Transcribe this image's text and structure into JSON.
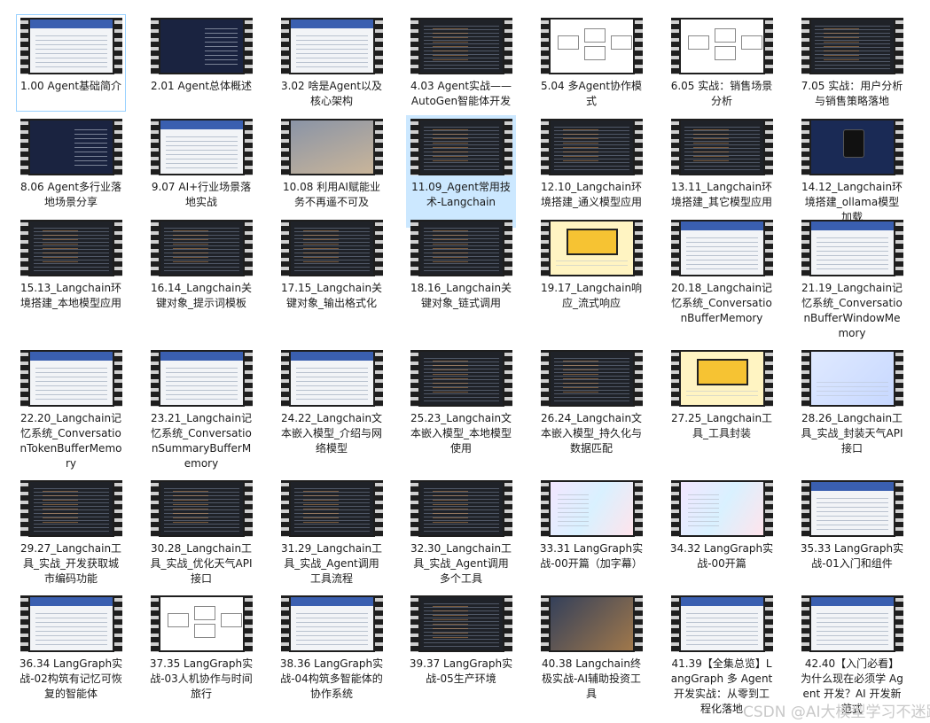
{
  "items": [
    {
      "label": "1.00 Agent基础简介",
      "thumb": "light",
      "state": "outline"
    },
    {
      "label": "2.01 Agent总体概述",
      "thumb": "navy",
      "state": ""
    },
    {
      "label": "3.02 啥是Agent以及核心架构",
      "thumb": "light",
      "state": ""
    },
    {
      "label": "4.03 Agent实战——AutoGen智能体开发",
      "thumb": "code",
      "state": ""
    },
    {
      "label": "5.04 多Agent协作模式",
      "thumb": "diagram",
      "state": ""
    },
    {
      "label": "6.05 实战：销售场景分析",
      "thumb": "diagram",
      "state": ""
    },
    {
      "label": "7.05 实战：用户分析与销售策略落地",
      "thumb": "code",
      "state": ""
    },
    {
      "label": "8.06 Agent多行业落地场景分享",
      "thumb": "navy",
      "state": ""
    },
    {
      "label": "9.07 AI+行业场景落地实战",
      "thumb": "light",
      "state": ""
    },
    {
      "label": "10.08 利用AI赋能业务不再遥不可及",
      "thumb": "cloud",
      "state": ""
    },
    {
      "label": "11.09_Agent常用技术-Langchain",
      "thumb": "code",
      "state": "selected"
    },
    {
      "label": "12.10_Langchain环境搭建_通义模型应用",
      "thumb": "code",
      "state": ""
    },
    {
      "label": "13.11_Langchain环境搭建_其它模型应用",
      "thumb": "code",
      "state": ""
    },
    {
      "label": "14.12_Langchain环境搭建_ollama模型加载",
      "thumb": "phone",
      "state": ""
    },
    {
      "label": "15.13_Langchain环境搭建_本地模型应用",
      "thumb": "code",
      "state": ""
    },
    {
      "label": "16.14_Langchain关键对象_提示词模板",
      "thumb": "code",
      "state": ""
    },
    {
      "label": "17.15_Langchain关键对象_输出格式化",
      "thumb": "code",
      "state": ""
    },
    {
      "label": "18.16_Langchain关键对象_链式调用",
      "thumb": "code",
      "state": ""
    },
    {
      "label": "19.17_Langchain响应_流式响应",
      "thumb": "yellow",
      "state": ""
    },
    {
      "label": "20.18_Langchain记忆系统_ConversationBufferMemory",
      "thumb": "light",
      "state": ""
    },
    {
      "label": "21.19_Langchain记忆系统_ConversationBufferWindowMemory",
      "thumb": "light",
      "state": ""
    },
    {
      "label": "22.20_Langchain记忆系统_ConversationTokenBufferMemory",
      "thumb": "light",
      "state": ""
    },
    {
      "label": "23.21_Langchain记忆系统_ConversationSummaryBufferMemory",
      "thumb": "light",
      "state": ""
    },
    {
      "label": "24.22_Langchain文本嵌入模型_介绍与网络模型",
      "thumb": "light",
      "state": ""
    },
    {
      "label": "25.23_Langchain文本嵌入模型_本地模型使用",
      "thumb": "code",
      "state": ""
    },
    {
      "label": "26.24_Langchain文本嵌入模型_持久化与数据匹配",
      "thumb": "code",
      "state": ""
    },
    {
      "label": "27.25_Langchain工具_工具封装",
      "thumb": "yellow",
      "state": ""
    },
    {
      "label": "28.26_Langchain工具_实战_封装天气API接口",
      "thumb": "blue",
      "state": ""
    },
    {
      "label": "29.27_Langchain工具_实战_开发获取城市编码功能",
      "thumb": "code",
      "state": ""
    },
    {
      "label": "30.28_Langchain工具_实战_优化天气API接口",
      "thumb": "code",
      "state": ""
    },
    {
      "label": "31.29_Langchain工具_实战_Agent调用工具流程",
      "thumb": "code",
      "state": ""
    },
    {
      "label": "32.30_Langchain工具_实战_Agent调用多个工具",
      "thumb": "code",
      "state": ""
    },
    {
      "label": "33.31 LangGraph实战-00开篇（加字幕）",
      "thumb": "pastel",
      "state": ""
    },
    {
      "label": "34.32 LangGraph实战-00开篇",
      "thumb": "pastel",
      "state": ""
    },
    {
      "label": "35.33 LangGraph实战-01入门和组件",
      "thumb": "light",
      "state": ""
    },
    {
      "label": "36.34 LangGraph实战-02构筑有记忆可恢复的智能体",
      "thumb": "light",
      "state": ""
    },
    {
      "label": "37.35 LangGraph实战-03人机协作与时间旅行",
      "thumb": "diagram",
      "state": ""
    },
    {
      "label": "38.36 LangGraph实战-04构筑多智能体的协作系统",
      "thumb": "light",
      "state": ""
    },
    {
      "label": "39.37 LangGraph实战-05生产环境",
      "thumb": "code",
      "state": ""
    },
    {
      "label": "40.38 Langchain终极实战-AI辅助投资工具",
      "thumb": "robot",
      "state": ""
    },
    {
      "label": "41.39【全集总览】LangGraph 多 Agent 开发实战：从零到工程化落地",
      "thumb": "light",
      "state": ""
    },
    {
      "label": "42.40【入门必看】为什么现在必须学 Agent 开发？AI 开发新范式",
      "thumb": "light",
      "state": ""
    }
  ],
  "watermark": "CSDN @AI大模型学习不迷路"
}
